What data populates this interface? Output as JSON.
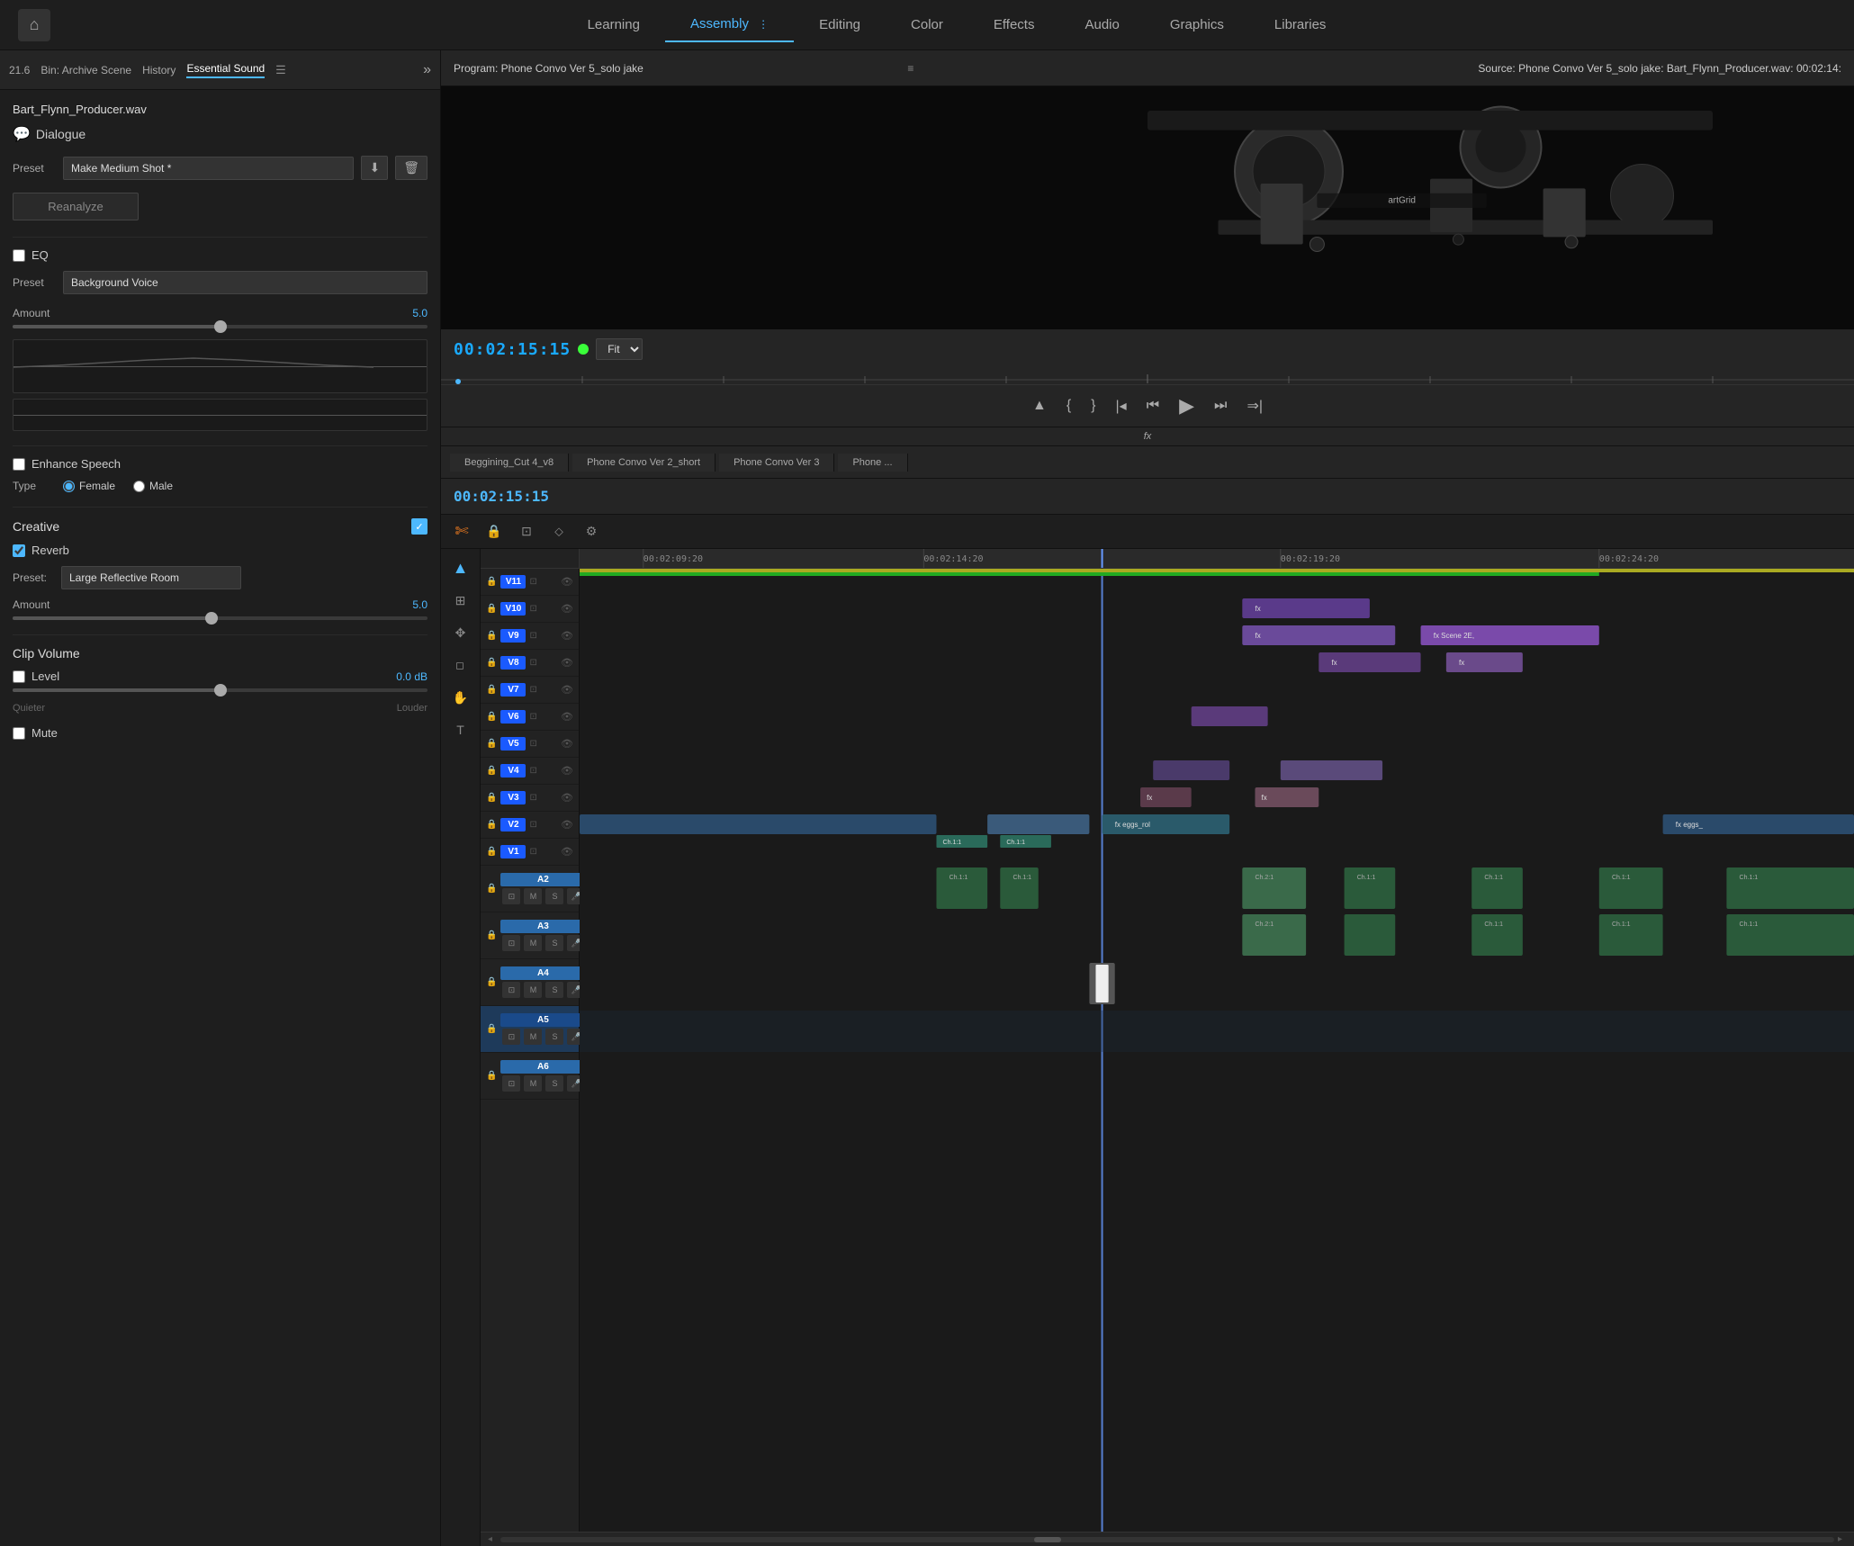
{
  "nav": {
    "home_icon": "⌂",
    "items": [
      {
        "label": "Learning",
        "active": false
      },
      {
        "label": "Assembly",
        "active": true,
        "has_menu": true
      },
      {
        "label": "Editing",
        "active": false
      },
      {
        "label": "Color",
        "active": false
      },
      {
        "label": "Effects",
        "active": false
      },
      {
        "label": "Audio",
        "active": false
      },
      {
        "label": "Graphics",
        "active": false
      },
      {
        "label": "Libraries",
        "active": false
      }
    ]
  },
  "sub_header": {
    "version": "21.6",
    "bin": "Bin: Archive Scene",
    "history": "History",
    "essential_sound": "Essential Sound",
    "expand_icon": "»"
  },
  "sound_panel": {
    "file_name": "Bart_Flynn_Producer.wav",
    "tag": "Dialogue",
    "preset_label": "Preset",
    "preset_value": "Make Medium Shot *",
    "save_icon": "⬇",
    "delete_icon": "🗑",
    "reanalyze_label": "Reanalyze",
    "eq": {
      "label": "EQ",
      "enabled": false,
      "preset_label": "Preset",
      "preset_value": "Background Voice",
      "amount_label": "Amount",
      "amount_value": "5.0",
      "slider_pct": 50
    },
    "enhance_speech": {
      "label": "Enhance Speech",
      "enabled": false,
      "type_label": "Type",
      "female": "Female",
      "male": "Male",
      "female_selected": true
    },
    "creative": {
      "title": "Creative",
      "enabled": true,
      "reverb_label": "Reverb",
      "reverb_enabled": true,
      "preset_label": "Preset:",
      "preset_value": "Large Reflective Room",
      "amount_label": "Amount",
      "amount_value": "5.0",
      "slider_pct": 48
    },
    "clip_volume": {
      "title": "Clip Volume",
      "level_label": "Level",
      "level_value": "0.0 dB",
      "level_enabled": false,
      "slider_pct": 50,
      "quieter": "Quieter",
      "louder": "Louder",
      "mute_label": "Mute",
      "mute_enabled": false
    }
  },
  "program_monitor": {
    "title": "Program: Phone Convo Ver 5_solo jake",
    "menu_icon": "≡",
    "source_title": "Source: Phone Convo Ver 5_solo jake: Bart_Flynn_Producer.wav: 00:02:14:",
    "timecode": "00:02:15:15",
    "fit_label": "Fit",
    "playback": {
      "mark_in": "▸",
      "mark_out": "◂",
      "in_point": "{",
      "out_point": "}",
      "add_marker": "◆",
      "step_back": "⏮",
      "play": "▶",
      "step_forward": "⏭",
      "loop": "↺",
      "fx_label": "fx"
    }
  },
  "timeline": {
    "timecode": "00:02:15:15",
    "sequence_tabs": [
      {
        "label": "Beggining_Cut 4_v8",
        "active": false
      },
      {
        "label": "Phone Convo Ver 2_short",
        "active": false
      },
      {
        "label": "Phone Convo Ver 3",
        "active": false
      },
      {
        "label": "Phone ...",
        "active": false
      }
    ],
    "timestamps": [
      "00:02:09:20",
      "00:02:14:20",
      "00:02:19:20",
      "00:02:24:20"
    ],
    "video_tracks": [
      {
        "name": "V11",
        "selected": true
      },
      {
        "name": "V10",
        "selected": true
      },
      {
        "name": "V9",
        "selected": true
      },
      {
        "name": "V8",
        "selected": true
      },
      {
        "name": "V7",
        "selected": true
      },
      {
        "name": "V6",
        "selected": true
      },
      {
        "name": "V5",
        "selected": true
      },
      {
        "name": "V4",
        "selected": true
      },
      {
        "name": "V3",
        "selected": true
      },
      {
        "name": "V2",
        "selected": true
      },
      {
        "name": "V1",
        "selected": true
      }
    ],
    "audio_tracks": [
      {
        "name": "A2"
      },
      {
        "name": "A3"
      },
      {
        "name": "A4"
      },
      {
        "name": "A5",
        "active": true
      },
      {
        "name": "A6"
      }
    ]
  }
}
